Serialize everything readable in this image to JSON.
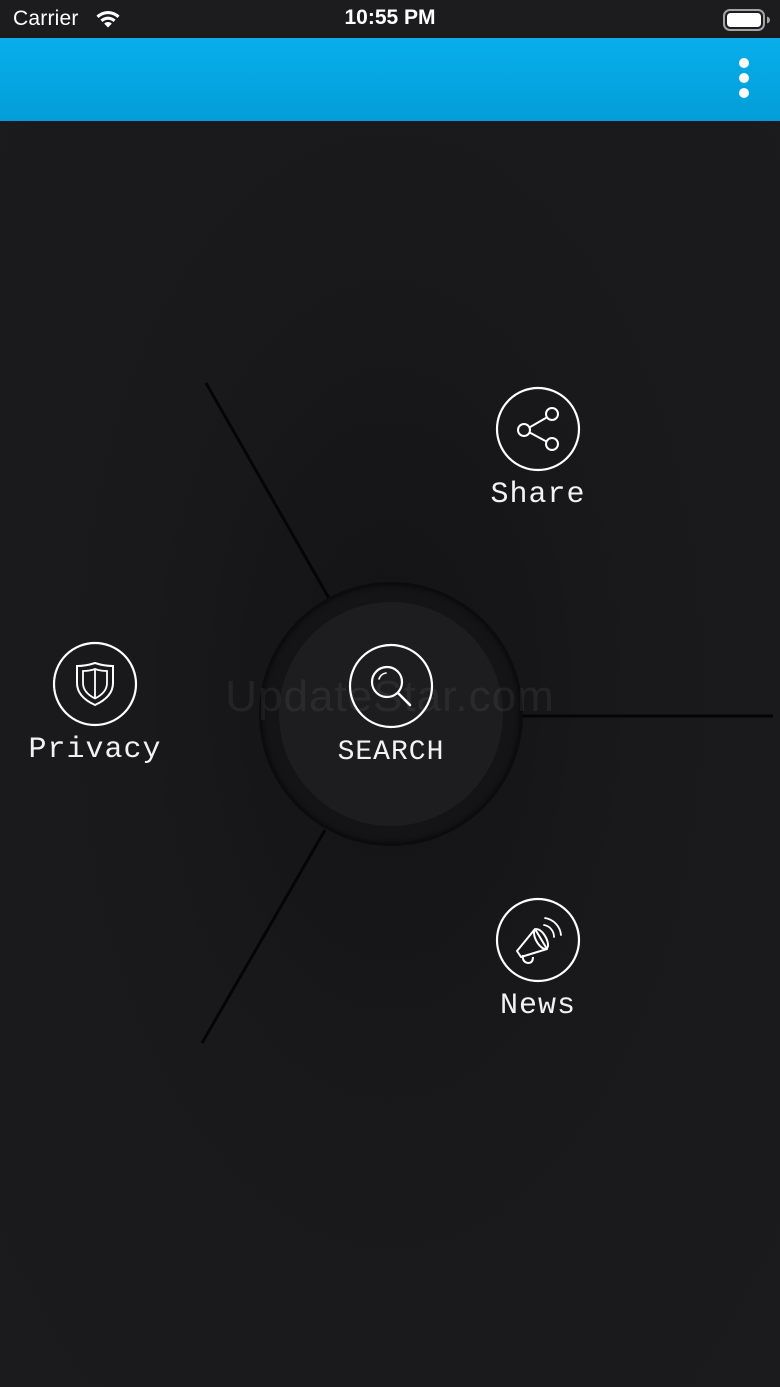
{
  "status_bar": {
    "carrier": "Carrier",
    "time": "10:55 PM",
    "wifi_icon": "wifi-icon",
    "battery_icon": "battery-full-icon"
  },
  "app_bar": {
    "color": "#029ed9",
    "menu_icon": "more-vertical-icon"
  },
  "watermark": "UpdateStar.com",
  "menu": {
    "center": {
      "label": "SEARCH",
      "icon": "search-icon"
    },
    "items": [
      {
        "label": "Share",
        "icon": "share-icon"
      },
      {
        "label": "Privacy",
        "icon": "shield-icon"
      },
      {
        "label": "News",
        "icon": "megaphone-icon"
      }
    ]
  },
  "colors": {
    "background": "#1a1a1c",
    "accent": "#029ed9",
    "text": "#ffffff"
  }
}
